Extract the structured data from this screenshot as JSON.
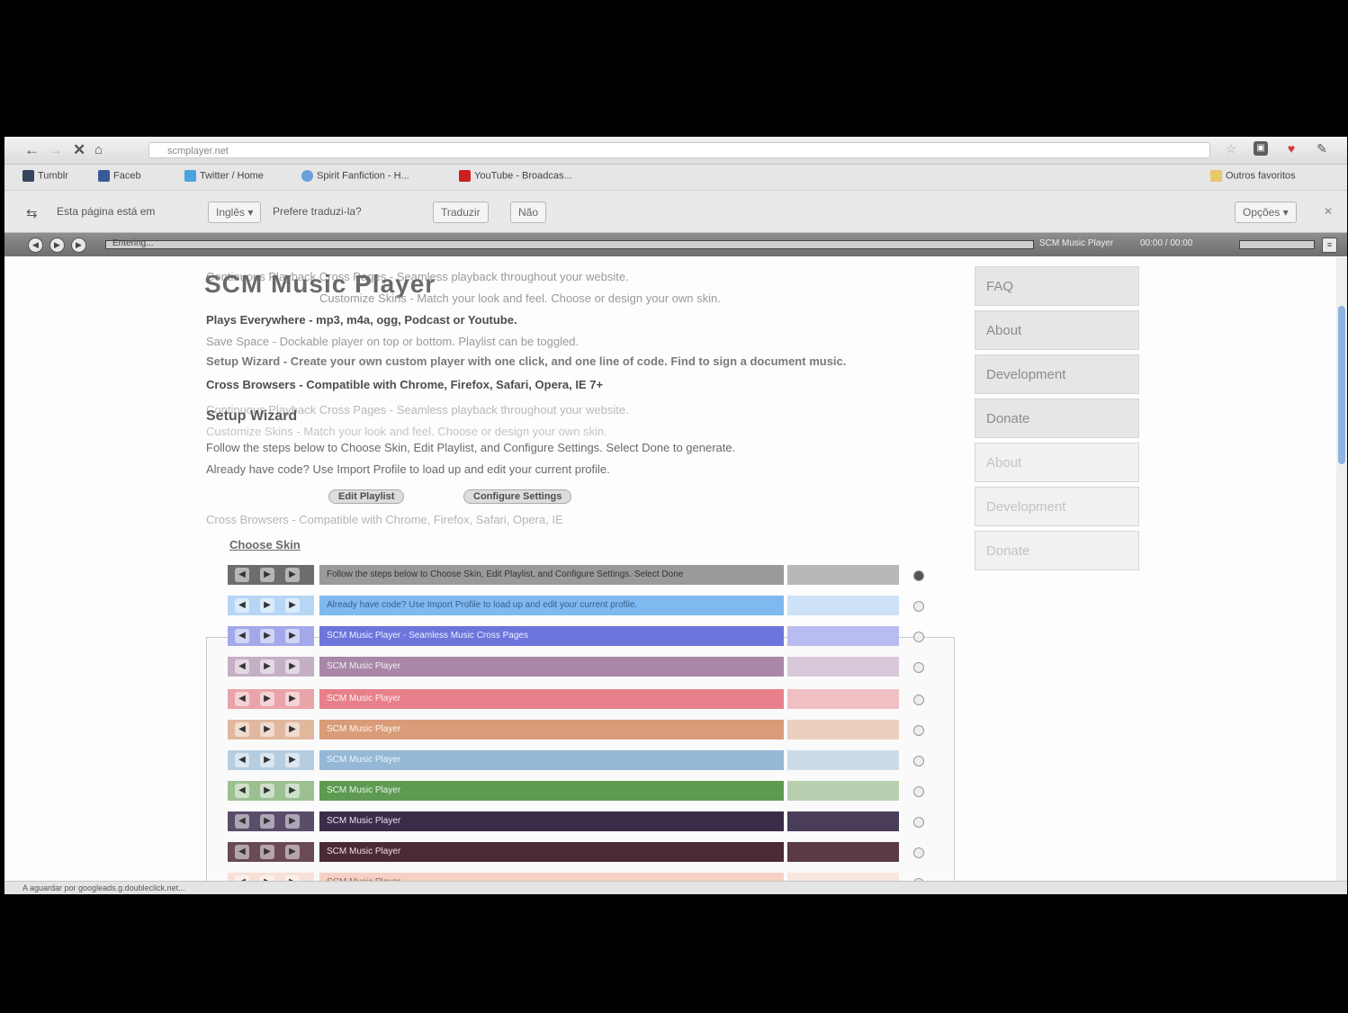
{
  "browser": {
    "url": "scmplayer.net",
    "bookmarks": [
      "Tumblr",
      "Faceb",
      "Twitter / Home",
      "Spirit Fanfiction - H...",
      "YouTube - Broadcas..."
    ],
    "other_bookmarks": "Outros favoritos"
  },
  "translate_bar": {
    "prompt": "Esta página está em",
    "language": "Inglês ▾",
    "question": "Prefere traduzi-la?",
    "translate_label": "Traduzir",
    "no_label": "Não",
    "options_label": "Opções ▾"
  },
  "scm_strip": {
    "loading": "Entering...",
    "title": "SCM Music Player",
    "time": "00:00 / 00:00"
  },
  "page": {
    "title": "SCM Music Player",
    "ghost_lines": [
      "Continuous Playback Cross Pages - Seamless playback throughout your website.",
      "Customize Skins - Match your look and feel. Choose or design your own skin.",
      "Plays Everywhere - mp3, m4a, ogg, Podcast or Youtube.",
      "Save Space - Dockable player on top or bottom. Playlist can be toggled.",
      "Setup Wizard - Create your own custom player with one click, and one line of code. Find to sign a document music.",
      "Cross Browsers - Compatible with Chrome, Firefox, Safari, Opera, IE 7+",
      "Continuous Playback Cross Pages - Seamless playback throughout your website.",
      "Customize Skins - Match your look and feel. Choose or design your own skin.",
      "Setup Wizard",
      "Follow the steps below to Choose Skin, Edit Playlist, and Configure Settings. Select Done to generate.",
      "Already have code? Use Import Profile to load up and edit your current profile.",
      "Edit Playlist",
      "Configure Settings",
      "Cross Browsers - Compatible with Chrome, Firefox, Safari, Opera, IE",
      "Choose Skin"
    ],
    "sidebar": [
      "FAQ",
      "About",
      "Development",
      "Donate"
    ],
    "sidebar_faint": [
      "About",
      "Development",
      "Donate"
    ],
    "status_text": "A aguardar por googleads.g.doubleclick.net...",
    "theme_rows": [
      {
        "title": "Follow the steps below to Choose Skin, Edit Playlist, and Configure Settings. Select Done",
        "color": "#9a9a9a",
        "ctrl": "#6d6d6d",
        "vol": "#b8b8b8",
        "text": "#333333"
      },
      {
        "title": "Already have code? Use Import Profile to load up and edit your current profile.",
        "color": "#80b9ef",
        "ctrl": "#b7d6f5",
        "vol": "#cde2f7",
        "text": "#355e8c"
      },
      {
        "title": "SCM Music Player - Seamless Music Cross Pages",
        "color": "#6b75db",
        "ctrl": "#a3a8ea",
        "vol": "#b9bcef",
        "text": "#eef0ff"
      },
      {
        "title": "SCM Music Player",
        "color": "#a887a8",
        "ctrl": "#c5afc5",
        "vol": "#d9c8d9",
        "text": "#f5eef5"
      },
      {
        "title": "SCM Music Player",
        "color": "#e7808a",
        "ctrl": "#e9a4aa",
        "vol": "#efbfc4",
        "text": "#fff3f4"
      },
      {
        "title": "SCM Music Player",
        "color": "#d99c79",
        "ctrl": "#e1b79e",
        "vol": "#ebd0c0",
        "text": "#fff6f0"
      },
      {
        "title": "SCM Music Player",
        "color": "#94b8d6",
        "ctrl": "#b6cde0",
        "vol": "#cddbe8",
        "text": "#f0f6fb"
      },
      {
        "title": "SCM Music Player",
        "color": "#5e9a52",
        "ctrl": "#9cc092",
        "vol": "#b7d0b0",
        "text": "#e9f4e6"
      },
      {
        "title": "SCM Music Player",
        "color": "#3a2d4a",
        "ctrl": "#5a4d6a",
        "vol": "#4a3d5a",
        "text": "#e8e0f0"
      },
      {
        "title": "SCM Music Player",
        "color": "#4a2a34",
        "ctrl": "#6a4a54",
        "vol": "#5a3a44",
        "text": "#f0dde3"
      },
      {
        "title": "SCM Music Player",
        "color": "#f6d1c3",
        "ctrl": "#f8e0d6",
        "vol": "#f9e6de",
        "text": "#8a6a5e"
      },
      {
        "title": "",
        "color": "#f4efc7",
        "ctrl": "#f7f3d8",
        "vol": "#f8f5e0",
        "text": "#8a865e"
      }
    ]
  }
}
